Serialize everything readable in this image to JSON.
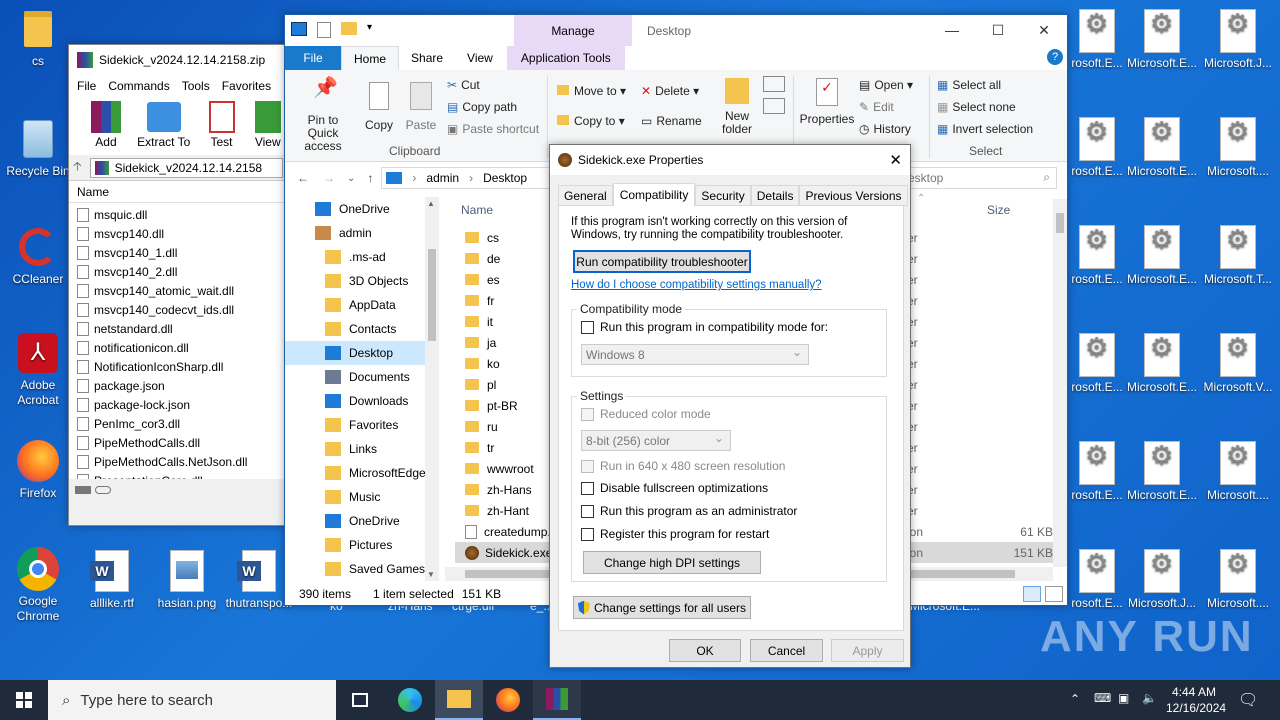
{
  "desktop_left": [
    {
      "label": "cs",
      "icon": "folder-icon"
    },
    {
      "label": "Recycle Bin",
      "icon": "recycle-bin-icon"
    },
    {
      "label": "CCleaner",
      "icon": "ccleaner-icon"
    },
    {
      "label": "Adobe Acrobat",
      "icon": "acrobat-icon"
    },
    {
      "label": "Firefox",
      "icon": "firefox-icon"
    },
    {
      "label": "Google Chrome",
      "icon": "chrome-icon"
    }
  ],
  "desktop_bottom": [
    {
      "label": "alllike.rtf"
    },
    {
      "label": "hasian.png"
    },
    {
      "label": "thutranspo..."
    }
  ],
  "desktop_bottom_partial": [
    "ko",
    "zh-Hans",
    "ctrge.dll",
    "e_..."
  ],
  "desktop_right": [
    [
      "rosoft.E...",
      "Microsoft.E...",
      "Microsoft.J..."
    ],
    [
      "rosoft.E...",
      "Microsoft.E...",
      "Microsoft...."
    ],
    [
      "rosoft.E...",
      "Microsoft.E...",
      "Microsoft.T..."
    ],
    [
      "rosoft.E...",
      "Microsoft.E...",
      "Microsoft.V..."
    ],
    [
      "rosoft.E...",
      "Microsoft.E...",
      "Microsoft...."
    ],
    [
      "rosoft.E...",
      "Microsoft.J...",
      "Microsoft...."
    ]
  ],
  "desktop_right_partial": [
    "Microsoft.E..."
  ],
  "watermark": "ANY RUN",
  "winrar": {
    "title": "Sidekick_v2024.12.14.2158.zip",
    "menu": [
      "File",
      "Commands",
      "Tools",
      "Favorites"
    ],
    "toolbar": [
      "Add",
      "Extract To",
      "Test",
      "View"
    ],
    "path": "Sidekick_v2024.12.14.2158",
    "col_name": "Name",
    "files": [
      "msquic.dll",
      "msvcp140.dll",
      "msvcp140_1.dll",
      "msvcp140_2.dll",
      "msvcp140_atomic_wait.dll",
      "msvcp140_codecvt_ids.dll",
      "netstandard.dll",
      "notificationicon.dll",
      "NotificationIconSharp.dll",
      "package.json",
      "package-lock.json",
      "PenImc_cor3.dll",
      "PipeMethodCalls.dll",
      "PipeMethodCalls.NetJson.dll",
      "PresentationCore.dll"
    ]
  },
  "explorer": {
    "title": "Desktop",
    "manage_tab": "Manage",
    "tabs": [
      "File",
      "Home",
      "Share",
      "View",
      "Application Tools"
    ],
    "ribbon": {
      "pin": "Pin to Quick access",
      "copy": "Copy",
      "paste": "Paste",
      "cut": "Cut",
      "copy_path": "Copy path",
      "paste_shortcut": "Paste shortcut",
      "clipboard_group": "Clipboard",
      "move_to": "Move to",
      "copy_to": "Copy to",
      "delete": "Delete",
      "rename": "Rename",
      "new_folder": "New folder",
      "properties": "Properties",
      "open": "Open",
      "edit": "Edit",
      "history": "History",
      "select_all": "Select all",
      "select_none": "Select none",
      "invert_selection": "Invert selection",
      "select_group": "Select"
    },
    "address": [
      "admin",
      "Desktop"
    ],
    "search_placeholder": "esktop",
    "nav": [
      "OneDrive",
      "admin",
      ".ms-ad",
      "3D Objects",
      "AppData",
      "Contacts",
      "Desktop",
      "Documents",
      "Downloads",
      "Favorites",
      "Links",
      "MicrosoftEdge",
      "Music",
      "OneDrive",
      "Pictures",
      "Saved Games"
    ],
    "col_name": "Name",
    "col_size": "Size",
    "items": [
      "cs",
      "de",
      "es",
      "fr",
      "it",
      "ja",
      "ko",
      "pl",
      "pt-BR",
      "ru",
      "tr",
      "wwwroot",
      "zh-Hans",
      "zh-Hant",
      "createdump.",
      "Sidekick.exe"
    ],
    "type_fragments": [
      "er",
      "er",
      "er",
      "er",
      "er",
      "er",
      "er",
      "er",
      "er",
      "er",
      "er",
      "er",
      "er",
      "er",
      "ion",
      "ion"
    ],
    "sizes": [
      "",
      "",
      "",
      "",
      "",
      "",
      "",
      "",
      "",
      "",
      "",
      "",
      "",
      "",
      "61 KB",
      "151 KB"
    ],
    "status_items": "390 items",
    "status_selected": "1 item selected",
    "status_size": "151 KB"
  },
  "dialog": {
    "title": "Sidekick.exe Properties",
    "tabs": [
      "General",
      "Compatibility",
      "Security",
      "Details",
      "Previous Versions"
    ],
    "intro": "If this program isn't working correctly on this version of Windows, try running the compatibility troubleshooter.",
    "run_troubleshooter": "Run compatibility troubleshooter",
    "manual_link": "How do I choose compatibility settings manually?",
    "compat_group": "Compatibility mode",
    "compat_check": "Run this program in compatibility mode for:",
    "compat_select": "Windows 8",
    "settings_group": "Settings",
    "reduced_color": "Reduced color mode",
    "color_select": "8-bit (256) color",
    "res_640": "Run in 640 x 480 screen resolution",
    "disable_fullscreen": "Disable fullscreen optimizations",
    "run_admin": "Run this program as an administrator",
    "register_restart": "Register this program for restart",
    "high_dpi": "Change high DPI settings",
    "change_all": "Change settings for all users",
    "ok": "OK",
    "cancel": "Cancel",
    "apply": "Apply"
  },
  "taskbar": {
    "search_placeholder": "Type here to search",
    "time": "4:44 AM",
    "date": "12/16/2024"
  }
}
